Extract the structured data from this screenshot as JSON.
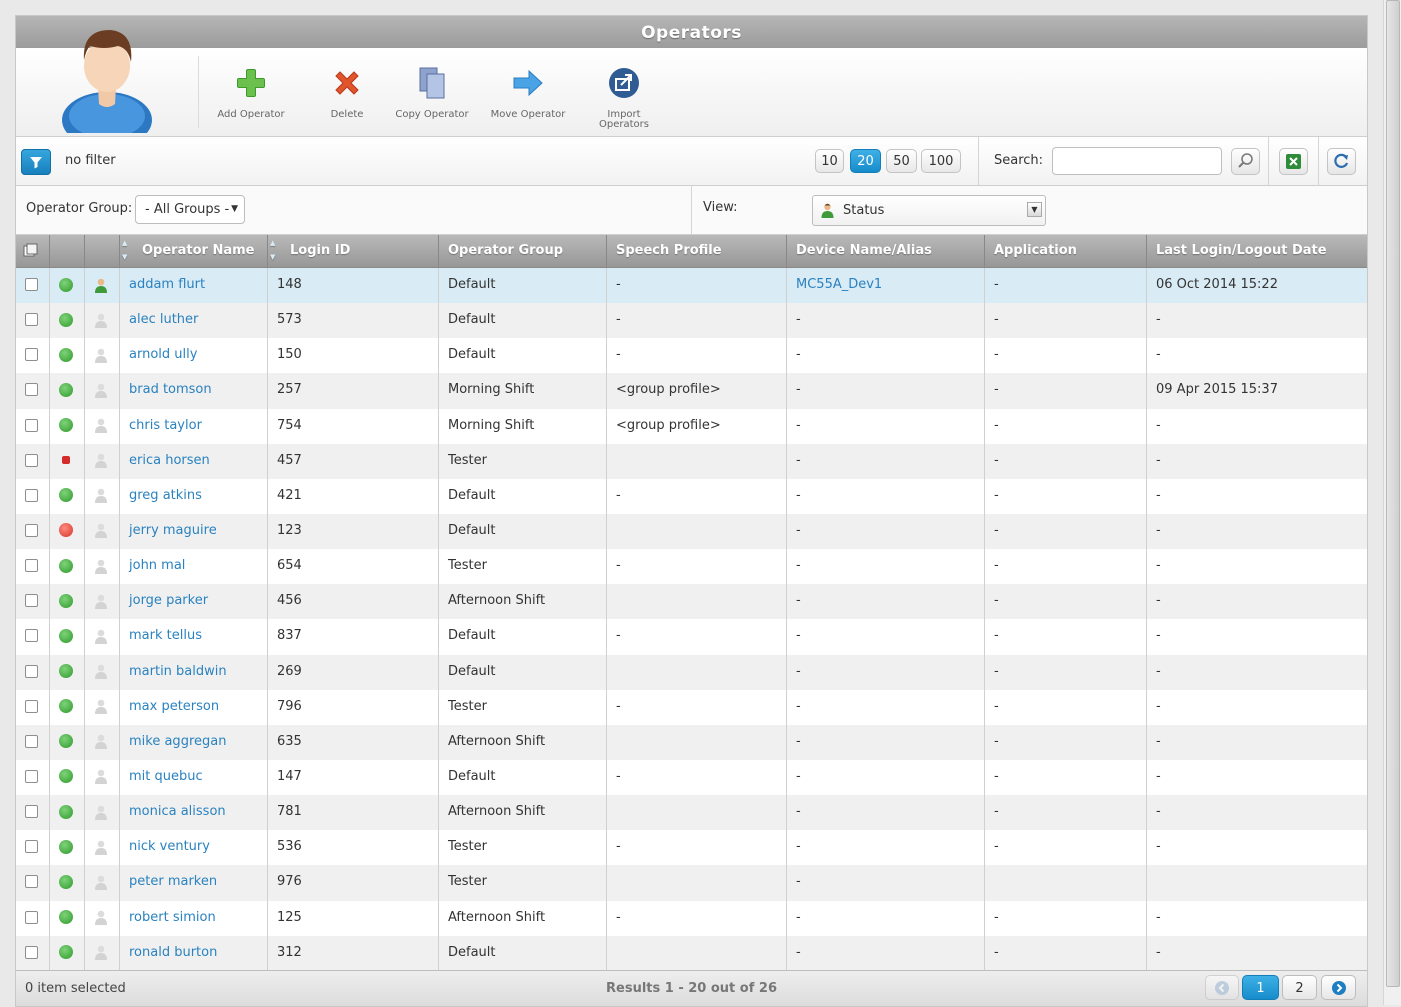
{
  "window": {
    "title": "Operators"
  },
  "toolbar": {
    "buttons": [
      {
        "label": "Add Operator",
        "icon": "plus-icon"
      },
      {
        "label": "Delete",
        "icon": "delete-x-icon"
      },
      {
        "label": "Copy Operator",
        "icon": "copy-icon"
      },
      {
        "label": "Move Operator",
        "icon": "arrow-right-icon"
      },
      {
        "label": "Import Operators",
        "icon": "import-icon"
      }
    ],
    "avatar_icon": "operator-avatar-icon"
  },
  "filter_bar": {
    "filter_text": "no filter",
    "page_sizes": [
      "10",
      "20",
      "50",
      "100"
    ],
    "active_page_size": "20",
    "search_label": "Search:",
    "search_value": ""
  },
  "group_bar": {
    "group_label": "Operator Group:",
    "group_value": "- All Groups -",
    "view_label": "View:",
    "view_value": "Status"
  },
  "columns": [
    "Operator Name",
    "Login ID",
    "Operator Group",
    "Speech Profile",
    "Device Name/Alias",
    "Application",
    "Last Login/Logout Date"
  ],
  "rows": [
    {
      "status": "ok",
      "active": true,
      "name": "addam flurt",
      "login": "148",
      "group": "Default",
      "speech": "-",
      "device": "MC55A_Dev1",
      "app": "-",
      "last": "06 Oct 2014 15:22"
    },
    {
      "status": "ok",
      "active": false,
      "name": "alec luther",
      "login": "573",
      "group": "Default",
      "speech": "-",
      "device": "-",
      "app": "-",
      "last": "-"
    },
    {
      "status": "ok",
      "active": false,
      "name": "arnold ully",
      "login": "150",
      "group": "Default",
      "speech": "-",
      "device": "-",
      "app": "-",
      "last": "-"
    },
    {
      "status": "ok",
      "active": false,
      "name": "brad tomson",
      "login": "257",
      "group": "Morning Shift",
      "speech": "<group profile>",
      "device": "-",
      "app": "-",
      "last": "09 Apr 2015 15:37"
    },
    {
      "status": "ok",
      "active": false,
      "name": "chris taylor",
      "login": "754",
      "group": "Morning Shift",
      "speech": "<group profile>",
      "device": "-",
      "app": "-",
      "last": "-"
    },
    {
      "status": "locked",
      "active": false,
      "name": "erica horsen",
      "login": "457",
      "group": "Tester",
      "speech": "",
      "device": "-",
      "app": "-",
      "last": "-"
    },
    {
      "status": "ok",
      "active": false,
      "name": "greg atkins",
      "login": "421",
      "group": "Default",
      "speech": "-",
      "device": "-",
      "app": "-",
      "last": "-"
    },
    {
      "status": "blocked",
      "active": false,
      "name": "jerry maguire",
      "login": "123",
      "group": "Default",
      "speech": "",
      "device": "-",
      "app": "-",
      "last": "-"
    },
    {
      "status": "ok",
      "active": false,
      "name": "john mal",
      "login": "654",
      "group": "Tester",
      "speech": "-",
      "device": "-",
      "app": "-",
      "last": "-"
    },
    {
      "status": "ok",
      "active": false,
      "name": "jorge parker",
      "login": "456",
      "group": "Afternoon Shift",
      "speech": "",
      "device": "-",
      "app": "-",
      "last": "-"
    },
    {
      "status": "ok",
      "active": false,
      "name": "mark tellus",
      "login": "837",
      "group": "Default",
      "speech": "-",
      "device": "-",
      "app": "-",
      "last": "-"
    },
    {
      "status": "ok",
      "active": false,
      "name": "martin baldwin",
      "login": "269",
      "group": "Default",
      "speech": "",
      "device": "-",
      "app": "-",
      "last": "-"
    },
    {
      "status": "ok",
      "active": false,
      "name": "max peterson",
      "login": "796",
      "group": "Tester",
      "speech": "-",
      "device": "-",
      "app": "-",
      "last": "-"
    },
    {
      "status": "ok",
      "active": false,
      "name": "mike aggregan",
      "login": "635",
      "group": "Afternoon Shift",
      "speech": "",
      "device": "-",
      "app": "-",
      "last": "-"
    },
    {
      "status": "ok",
      "active": false,
      "name": "mit quebuc",
      "login": "147",
      "group": "Default",
      "speech": "-",
      "device": "-",
      "app": "-",
      "last": "-"
    },
    {
      "status": "ok",
      "active": false,
      "name": "monica alisson",
      "login": "781",
      "group": "Afternoon Shift",
      "speech": "",
      "device": "-",
      "app": "-",
      "last": "-"
    },
    {
      "status": "ok",
      "active": false,
      "name": "nick ventury",
      "login": "536",
      "group": "Tester",
      "speech": "-",
      "device": "-",
      "app": "-",
      "last": "-"
    },
    {
      "status": "ok",
      "active": false,
      "name": "peter marken",
      "login": "976",
      "group": "Tester",
      "speech": "",
      "device": "-",
      "app": "",
      "last": ""
    },
    {
      "status": "ok",
      "active": false,
      "name": "robert simion",
      "login": "125",
      "group": "Afternoon Shift",
      "speech": "-",
      "device": "-",
      "app": "-",
      "last": "-"
    },
    {
      "status": "ok",
      "active": false,
      "name": "ronald burton",
      "login": "312",
      "group": "Default",
      "speech": "",
      "device": "-",
      "app": "-",
      "last": "-"
    }
  ],
  "footer": {
    "selection": "0 item selected",
    "results": "Results 1 - 20 out of 26",
    "pages": [
      "1",
      "2"
    ],
    "current_page": "1"
  },
  "colors": {
    "accent": "#1d8fcf",
    "link": "#2a82c0",
    "header": "#a5a5a5"
  }
}
